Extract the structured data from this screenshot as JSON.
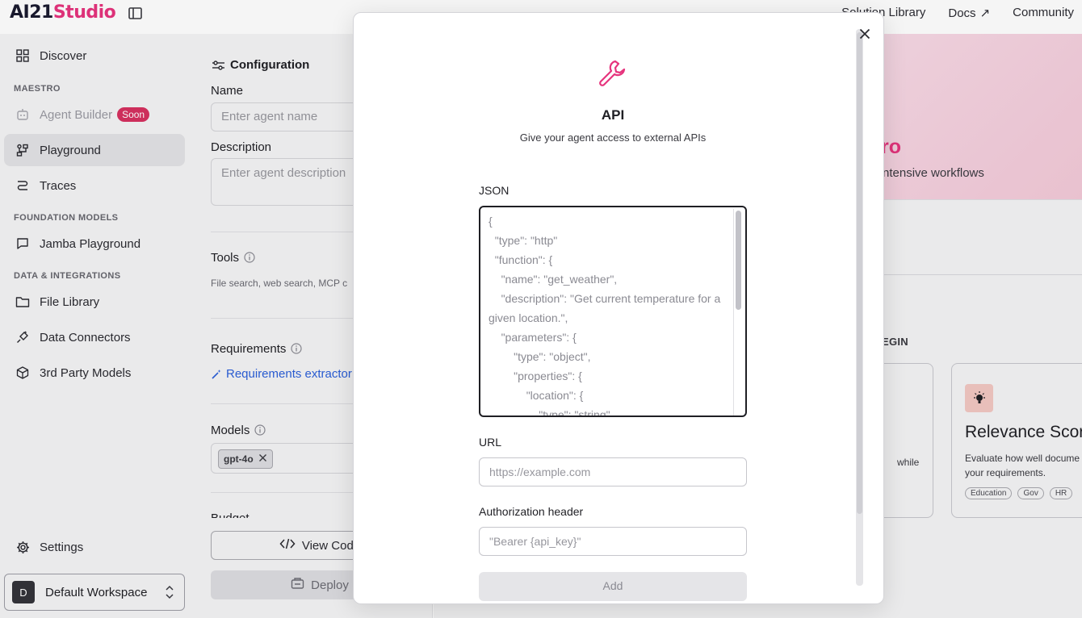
{
  "app": {
    "logo_main": "AI21",
    "logo_studio": "Studio"
  },
  "topnav": {
    "solution_library": "Solution Library",
    "docs": "Docs",
    "community": "Community"
  },
  "sidebar": {
    "discover": "Discover",
    "section_maestro": "MAESTRO",
    "agent_builder": "Agent Builder",
    "agent_builder_badge": "Soon",
    "playground": "Playground",
    "traces": "Traces",
    "section_foundation": "FOUNDATION MODELS",
    "jamba_playground": "Jamba Playground",
    "section_data": "DATA & INTEGRATIONS",
    "file_library": "File Library",
    "data_connectors": "Data Connectors",
    "third_party_models": "3rd Party Models",
    "settings": "Settings",
    "workspace_initial": "D",
    "workspace_name": "Default Workspace"
  },
  "config": {
    "title": "Configuration",
    "name_label": "Name",
    "name_placeholder": "Enter agent name",
    "description_label": "Description",
    "description_placeholder": "Enter agent description",
    "tools_label": "Tools",
    "tools_hint": "File search, web search, MCP c",
    "requirements_label": "Requirements",
    "requirements_link": "Requirements extractor",
    "models_label": "Models",
    "model_chip": "gpt-4o",
    "budget_label_partial": "Budget",
    "view_code": "View Code",
    "deploy": "Deploy"
  },
  "main": {
    "hero_title_partial": "ro",
    "hero_sub_partial": "ntensive workflows",
    "begin_partial": "EGIN",
    "card1_text_partial": "while",
    "card2": {
      "title": "Relevance Scor",
      "desc_line1": "Evaluate how well docume",
      "desc_line2": "your requirements.",
      "tags": [
        "Education",
        "Gov",
        "HR"
      ]
    }
  },
  "modal": {
    "title": "API",
    "subtitle": "Give your agent access to external APIs",
    "json_label": "JSON",
    "json_placeholder": "{\n  \"type\": \"http\"\n  \"function\": {\n    \"name\": \"get_weather\",\n    \"description\": \"Get current temperature for a given location.\",\n    \"parameters\": {\n        \"type\": \"object\",\n        \"properties\": {\n            \"location\": {\n                \"type\": \"string\",",
    "url_label": "URL",
    "url_placeholder": "https://example.com",
    "auth_label": "Authorization header",
    "auth_placeholder": "\"Bearer {api_key}\"",
    "add_button": "Add"
  },
  "colors": {
    "brand_pink": "#e6347d",
    "badge_red": "#d6305f",
    "link_blue": "#2b5fd9"
  }
}
